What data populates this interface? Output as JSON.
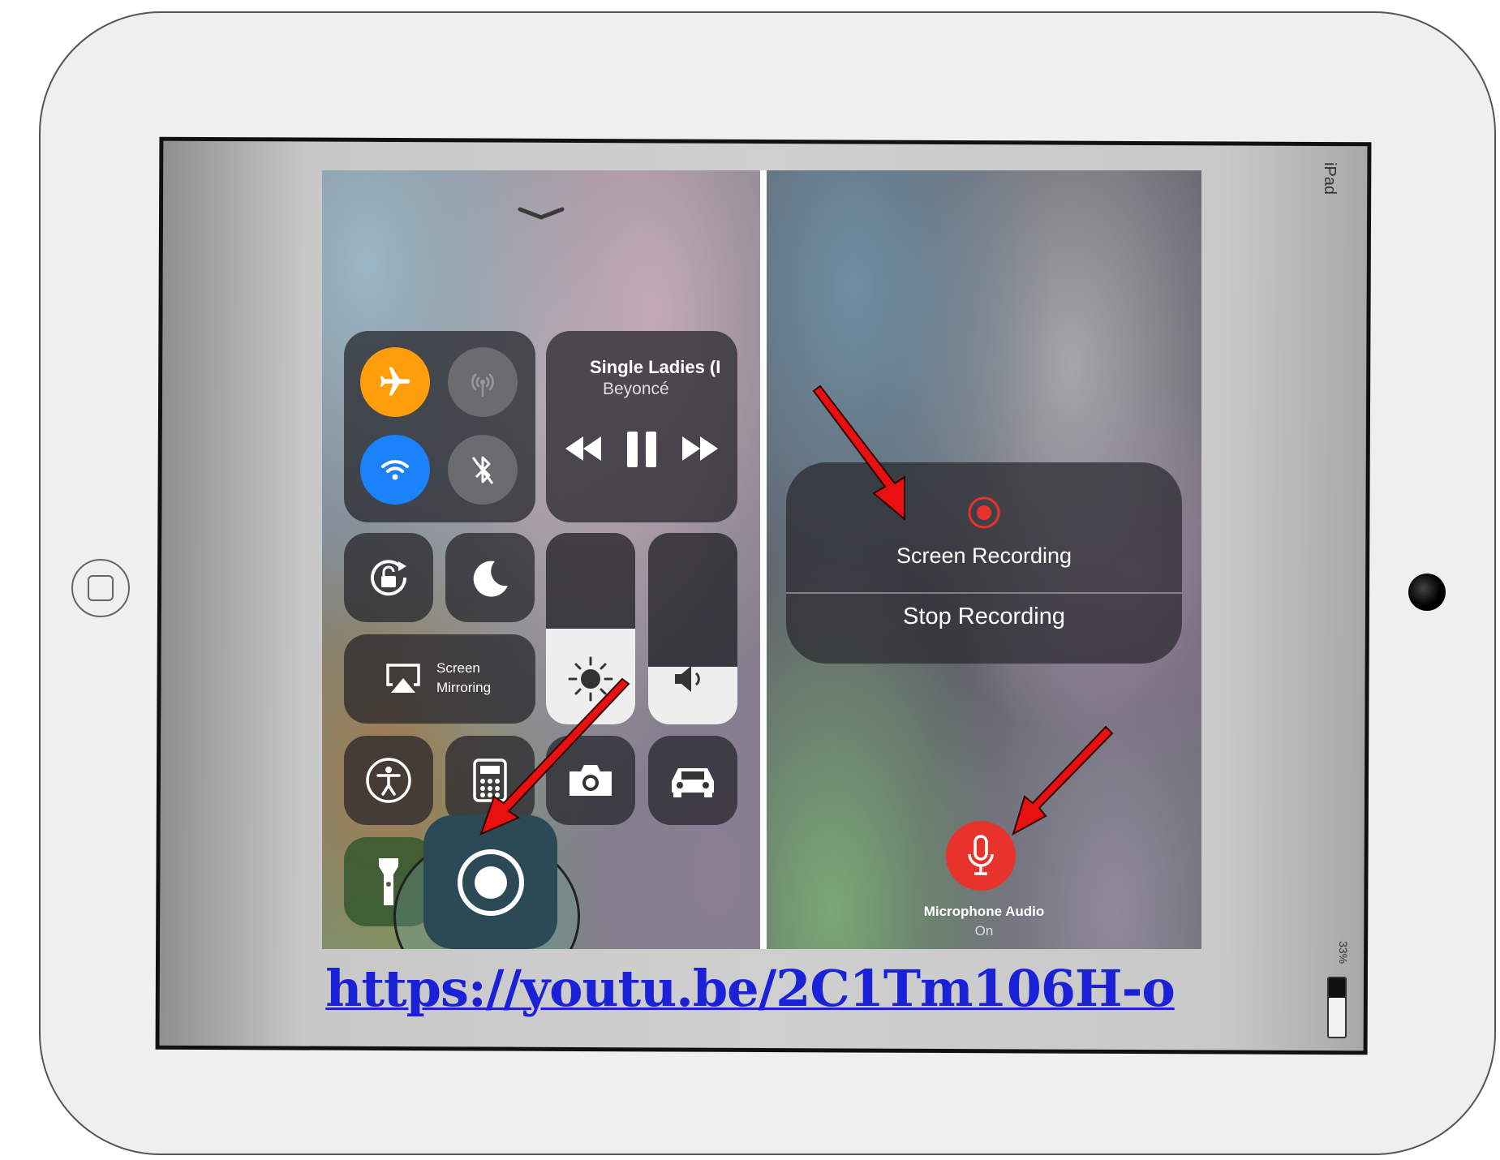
{
  "device": {
    "label": "iPad",
    "battery_percent": "33%",
    "battery_level": 0.33
  },
  "control_center": {
    "now_playing": {
      "title": "Single Ladies (I",
      "artist": "Beyoncé"
    },
    "screen_mirroring": {
      "line1": "Screen",
      "line2": "Mirroring"
    },
    "brightness_level": 0.5,
    "volume_level": 0.3,
    "colors": {
      "airplane": "#ff9d0a",
      "wifi": "#1a82fb",
      "inactive": "#6c6c70"
    }
  },
  "recording_panel": {
    "title": "Screen Recording",
    "stop_label": "Stop Recording",
    "mic_title": "Microphone Audio",
    "mic_state": "On",
    "colors": {
      "record": "#e8322c"
    }
  },
  "link": {
    "text": "https://youtu.be/2C1Tm106H-o"
  },
  "colors": {
    "annotation_arrow": "#e81010",
    "link": "#1a21d6"
  }
}
